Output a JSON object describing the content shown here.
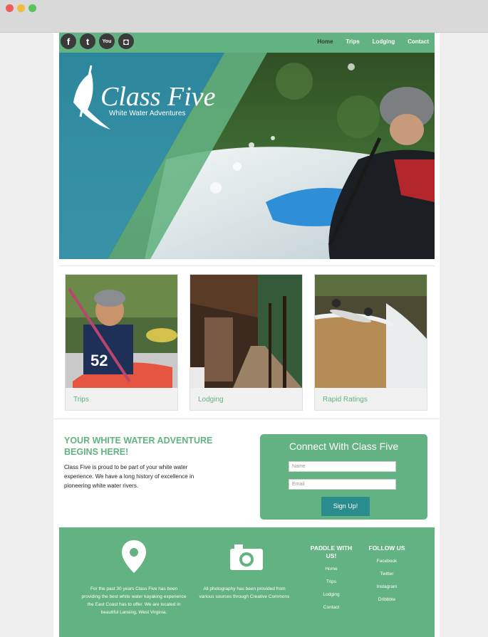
{
  "nav": {
    "social": [
      {
        "icon": "facebook-icon",
        "glyph": "f"
      },
      {
        "icon": "twitter-icon",
        "glyph": "t"
      },
      {
        "icon": "youtube-icon",
        "glyph": "You"
      },
      {
        "icon": "instagram-icon",
        "glyph": "◘"
      }
    ],
    "items": [
      "Home",
      "Trips",
      "Lodging",
      "Contact"
    ]
  },
  "hero": {
    "logo_title": "Class Five",
    "logo_subtitle": "White Water Adventures"
  },
  "cards": [
    {
      "label": "Trips"
    },
    {
      "label": "Lodging"
    },
    {
      "label": "Rapid Ratings"
    }
  ],
  "intro": {
    "title": "Your White Water Adventure Begins Here!",
    "text": "Class Five is proud to be part of your white water experience. We have a long history of excellence in pioneering white water rivers."
  },
  "connect": {
    "title": "Connect With Class Five",
    "name_placeholder": "Name",
    "email_placeholder": "Email",
    "button": "Sign Up!"
  },
  "footer": {
    "about": "For the past 30 years Class Five has been providing the best white water kayaking experience the East Coast has to offer. We are located in beautiful Lansing, West Virginia.",
    "photo_credit": "All photography has been provided from various sources through Creative Commons",
    "paddle_heading": "PADDLE WITH US!",
    "paddle_links": [
      "Home",
      "Trips",
      "Lodging",
      "Contact"
    ],
    "follow_heading": "FOLLOW US",
    "follow_links": [
      "Facebook",
      "Twitter",
      "Instagram",
      "Dribbble"
    ]
  },
  "colors": {
    "brand_green": "#63b281",
    "button_teal": "#2a8c8c"
  }
}
